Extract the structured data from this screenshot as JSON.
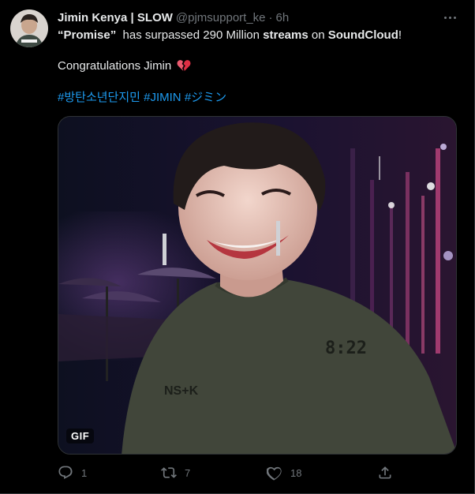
{
  "tweet": {
    "display_name": "Jimin Kenya | SLOW",
    "handle": "@pjmsupport_ke",
    "separator": "·",
    "time": "6h",
    "line1": {
      "q_open": "“",
      "song": "Promise",
      "q_close": "”",
      "mid": "  has surpassed 290 Million ",
      "streams_word": "streams",
      "on_word": " on ",
      "platform": "SoundCloud",
      "end": "!"
    },
    "line2": "Congratulations Jimin",
    "line2_emoji": "broken-heart-emoji",
    "hashtags": [
      "#방탄소년단지민",
      "#JIMIN",
      "#ジミン"
    ],
    "media": {
      "badge": "GIF",
      "shirt_text": "8:22",
      "shirt_logo": "NS+K"
    },
    "actions": {
      "reply_count": "1",
      "retweet_count": "7",
      "like_count": "18"
    }
  },
  "colors": {
    "background": "#000000",
    "text": "#e7e9ea",
    "muted": "#71767b",
    "link": "#1d9bf0",
    "border": "#2f3336"
  },
  "icons": {
    "more": "more-horizontal-icon",
    "reply": "reply-icon",
    "retweet": "retweet-icon",
    "like": "heart-icon",
    "share": "share-icon"
  }
}
